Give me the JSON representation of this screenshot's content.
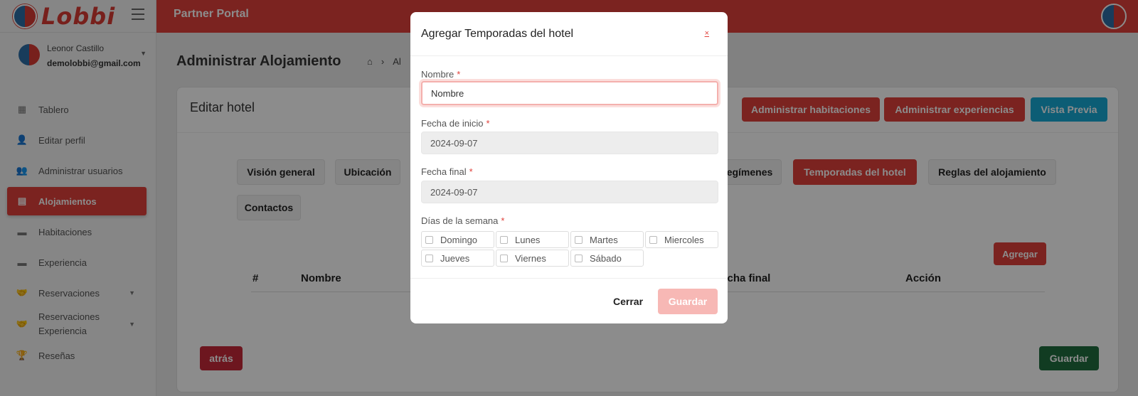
{
  "brand": {
    "name": "Lobbi"
  },
  "topbar": {
    "title": "Partner Portal"
  },
  "user": {
    "name": "Leonor Castillo",
    "email": "demolobbi@gmail.com"
  },
  "sidebar": {
    "items": [
      {
        "label": "Tablero",
        "icon": "dashboard-icon"
      },
      {
        "label": "Editar perfil",
        "icon": "user-edit-icon"
      },
      {
        "label": "Administrar usuarios",
        "icon": "users-icon"
      },
      {
        "label": "Alojamientos",
        "icon": "building-icon"
      },
      {
        "label": "Habitaciones",
        "icon": "bed-icon"
      },
      {
        "label": "Experiencia",
        "icon": "bed-icon"
      },
      {
        "label": "Reservaciones",
        "icon": "handshake-icon"
      },
      {
        "label": "Reservaciones Experiencia",
        "icon": "handshake-icon"
      },
      {
        "label": "Reseñas",
        "icon": "trophy-icon"
      }
    ]
  },
  "main": {
    "page_title": "Administrar Alojamiento",
    "breadcrumb": [
      "Al"
    ],
    "card_title": "Editar hotel",
    "header_buttons": {
      "rooms": "Administrar habitaciones",
      "experiences": "Administrar experiencias",
      "preview": "Vista Previa"
    },
    "tabs": [
      "Visión general",
      "Ubicación",
      "egímenes",
      "Temporadas del hotel",
      "Reglas del alojamiento",
      "Contactos"
    ],
    "add_button": "Agregar",
    "table_headers": [
      "#",
      "Nombre",
      "Fecha final",
      "Acción"
    ],
    "back_button": "atrás",
    "save_button": "Guardar"
  },
  "modal": {
    "title": "Agregar Temporadas del hotel",
    "close": "×",
    "name_label": "Nombre",
    "name_value": "Nombre",
    "start_label": "Fecha de inicio",
    "start_value": "2024-09-07",
    "end_label": "Fecha final",
    "end_value": "2024-09-07",
    "days_label": "Días de la semana",
    "days": [
      "Domingo",
      "Lunes",
      "Martes",
      "Miercoles",
      "Jueves",
      "Viernes",
      "Sábado"
    ],
    "required_mark": "*",
    "cancel": "Cerrar",
    "save": "Guardar"
  },
  "colors": {
    "primary": "#e0413b",
    "cyan": "#17a9d6",
    "green": "#1f6e3f",
    "back": "#c6283a"
  }
}
